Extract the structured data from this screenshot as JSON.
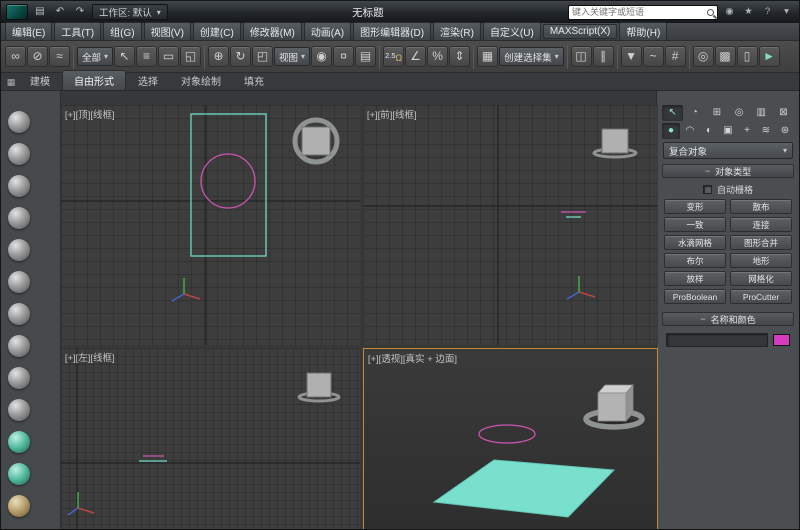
{
  "title_bar": {
    "workspace_label": "工作区: 默认",
    "document_title": "无标题",
    "search_placeholder": "键入关键字或短语"
  },
  "menu": {
    "items": [
      "编辑(E)",
      "工具(T)",
      "组(G)",
      "视图(V)",
      "创建(C)",
      "修改器(M)",
      "动画(A)",
      "图形编辑器(D)",
      "渲染(R)",
      "自定义(U)",
      "MAXScript(X)",
      "帮助(H)"
    ]
  },
  "toolbar": {
    "selection_filter": "全部",
    "coord_system": "视图",
    "snap_value": "2.5",
    "named_sets_label": "创建选择集"
  },
  "ribbon": {
    "tabs": [
      "建模",
      "自由形式",
      "选择",
      "对象绘制",
      "填充"
    ],
    "active": "自由形式"
  },
  "viewports": {
    "top": {
      "label": "[+][顶][线框]"
    },
    "front": {
      "label": "[+][前][线框]"
    },
    "left": {
      "label": "[+][左][线框]"
    },
    "perspective": {
      "label": "[+][透视][真实 + 边面]"
    }
  },
  "command_panel": {
    "category": "复合对象",
    "rollout_object_type": "对象类型",
    "autogrid_label": "自动栅格",
    "object_type_buttons": [
      "变形",
      "散布",
      "一致",
      "连接",
      "水滴网格",
      "图形合并",
      "布尔",
      "地形",
      "放样",
      "网格化",
      "ProBoolean",
      "ProCutter"
    ],
    "rollout_name_color": "名称和颜色"
  },
  "colors": {
    "active_viewport_border": "#c68b2c",
    "object_teal": "#6fdcc6",
    "spline_pink": "#cc55b0",
    "object_color_swatch": "#d63bbe"
  },
  "icons": {
    "save": "▤",
    "undo": "↶",
    "redo": "↷",
    "dropdown_arrow": "▾",
    "select_link": "∞",
    "unlink": "⊘",
    "bind_spacewarp": "≈",
    "select_object": "↖",
    "select_by_name": "≡",
    "rect_region": "▭",
    "window_crossing": "◱",
    "move": "⊕",
    "rotate": "↻",
    "scale": "◰",
    "pivot_center": "◉",
    "manipulate": "¤",
    "keyboard_override": "▤",
    "magnet": "Ω",
    "angle_snap": "∠",
    "percent": "%",
    "spinner_snap": "⇕",
    "edit_sets": "▦",
    "mirror": "◫",
    "align": "∥",
    "ribbon_toggle": "▼",
    "curve_editor": "~",
    "schematic": "#",
    "material_editor": "◎",
    "render_setup": "▩",
    "render_frame": "▯",
    "render": "►",
    "user": "◉",
    "star": "★",
    "help": "?",
    "minus": "−",
    "ribbon_menu": "▦",
    "tab_create": "↖",
    "tab_modify": "◔",
    "tab_hierarchy": "⊞",
    "tab_motion": "◎",
    "tab_display": "▥",
    "tab_utilities": "⊠",
    "cat_geometry": "●",
    "cat_shapes": "◠",
    "cat_lights": "◐",
    "cat_cameras": "▣",
    "cat_helpers": "+",
    "cat_spacewarps": "≋",
    "cat_systems": "⊛"
  }
}
